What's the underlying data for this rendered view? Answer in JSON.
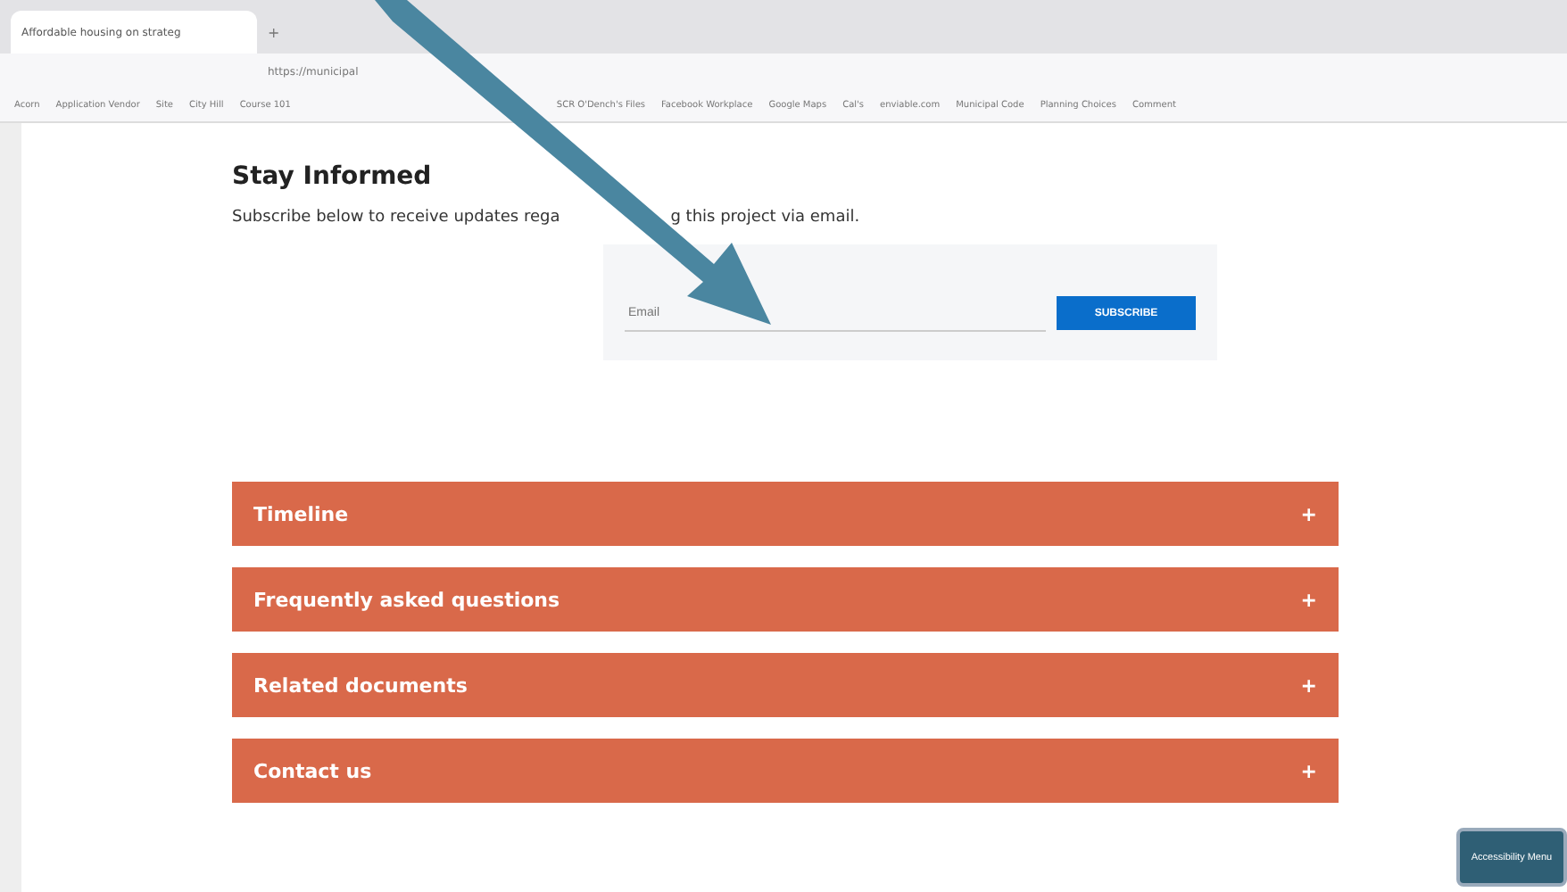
{
  "browser": {
    "tab_title": "Affordable housing on strateg",
    "new_tab": "+",
    "url": "https://municipal",
    "bookmarks": [
      "Acorn",
      "Application Vendor",
      "Site",
      "City Hill",
      "Course 101",
      "SCR O'Dench's Files",
      "Facebook Workplace",
      "Google Maps",
      "Cal's",
      "enviable.com",
      "Municipal Code",
      "Planning Choices",
      "Comment"
    ]
  },
  "subscribe": {
    "title": "Stay Informed",
    "text": [
      "Subscribe below to receive updates rega",
      "g this project via email."
    ],
    "placeholder": "Email",
    "button": "SUBSCRIBE"
  },
  "accordion": [
    {
      "label": "Timeline",
      "icon": "+",
      "expanded": false
    },
    {
      "label": "Frequently asked questions",
      "icon": "+",
      "expanded": false
    },
    {
      "label": "Related documents",
      "icon": "+",
      "expanded": false
    },
    {
      "label": "Contact us",
      "icon": "+",
      "expanded": false
    }
  ],
  "accessibility_button": "Accessibility Menu"
}
